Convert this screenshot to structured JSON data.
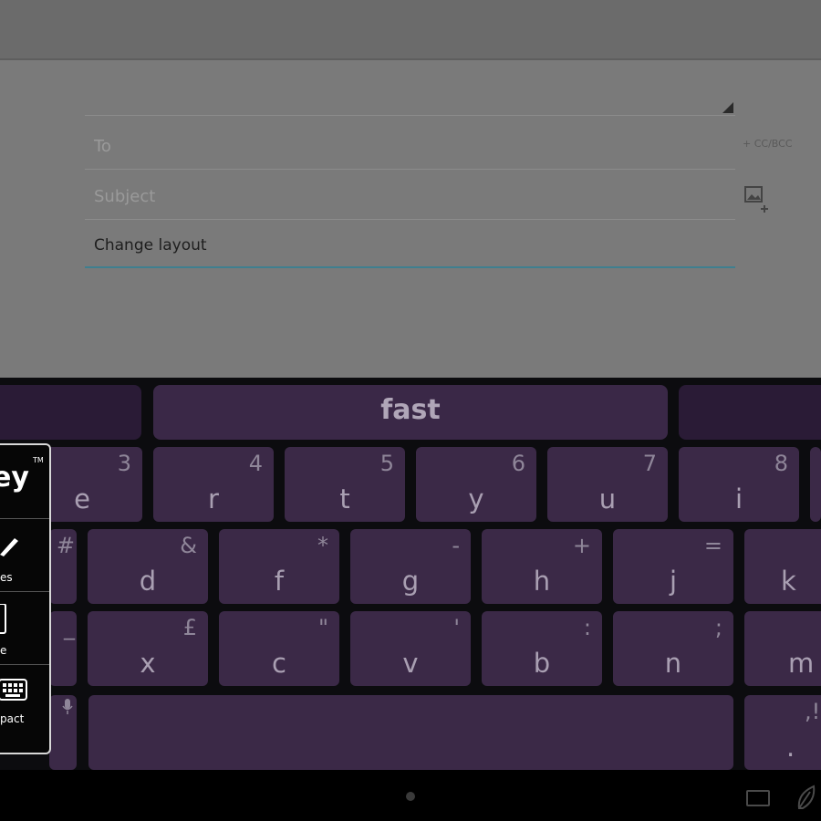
{
  "compose": {
    "to_placeholder": "To",
    "cc_bcc_label": "+ CC/BCC",
    "subject_placeholder": "Subject",
    "body_text": "Change layout"
  },
  "keyboard": {
    "suggestions": [
      "",
      "fast",
      ""
    ],
    "row1": [
      {
        "main": "e",
        "alt": "3"
      },
      {
        "main": "r",
        "alt": "4"
      },
      {
        "main": "t",
        "alt": "5"
      },
      {
        "main": "y",
        "alt": "6"
      },
      {
        "main": "u",
        "alt": "7"
      },
      {
        "main": "i",
        "alt": "8"
      }
    ],
    "row2": [
      {
        "main": "",
        "alt": "#"
      },
      {
        "main": "d",
        "alt": "&"
      },
      {
        "main": "f",
        "alt": "*"
      },
      {
        "main": "g",
        "alt": "-"
      },
      {
        "main": "h",
        "alt": "+"
      },
      {
        "main": "j",
        "alt": "="
      },
      {
        "main": "k",
        "alt": ""
      }
    ],
    "row3": [
      {
        "main": "",
        "alt": "_"
      },
      {
        "main": "x",
        "alt": "£"
      },
      {
        "main": "c",
        "alt": "\""
      },
      {
        "main": "v",
        "alt": "'"
      },
      {
        "main": "b",
        "alt": ":"
      },
      {
        "main": "n",
        "alt": ";"
      },
      {
        "main": "m",
        "alt": ""
      }
    ],
    "row4_right": {
      "main": ".",
      "alt": ",!"
    },
    "popup": {
      "brand": "ey",
      "trademark": "TM",
      "items": [
        "es",
        "e",
        "pact"
      ]
    }
  },
  "colors": {
    "key": "#3b2947",
    "keyboard_bg": "#0c0c0f",
    "accent_line": "#3f7f8f"
  }
}
